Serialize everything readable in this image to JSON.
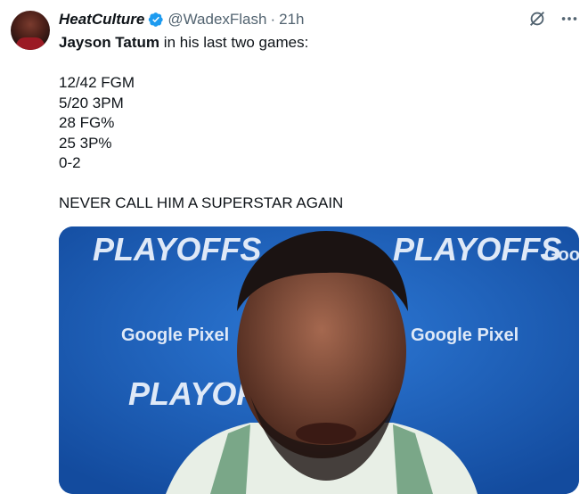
{
  "tweet": {
    "display_name": "HeatCulture",
    "handle": "@WadexFlash",
    "separator": "·",
    "time": "21h",
    "text_mention": "Jayson Tatum",
    "text_intro": " in his last two games:",
    "stats": [
      "12/42 FGM",
      "5/20 3PM",
      "28 FG%",
      "25 3P%",
      "0-2"
    ],
    "closing": "NEVER CALL HIM A SUPERSTAR AGAIN"
  },
  "icons": {
    "verified": "verified-badge-icon",
    "grok": "grok-icon",
    "more": "more-options-icon"
  },
  "media": {
    "backdrop_text": [
      "PLAYOFFS",
      "Google Pixel",
      "PLAYOFFS",
      "Google Pixel",
      "PLAYOFFS",
      "Goo"
    ],
    "colors": {
      "backdrop": "#1e5fb7",
      "jersey": "#e8efe6"
    }
  },
  "colors": {
    "verified": "#1d9bf0",
    "secondary_text": "#536471"
  }
}
